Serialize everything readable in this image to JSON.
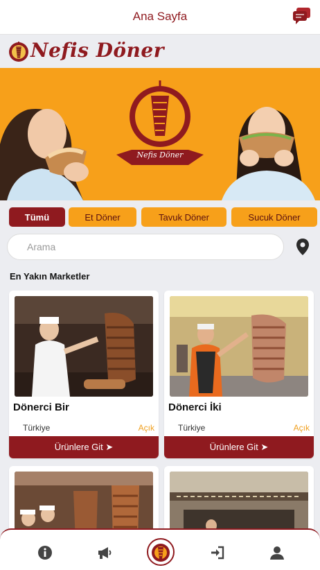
{
  "header": {
    "title": "Ana Sayfa"
  },
  "brand": {
    "name": "Nefis Döner",
    "banner_logo_text": "Nefis Döner"
  },
  "filters": [
    {
      "label": "Tümü",
      "active": true
    },
    {
      "label": "Et Döner",
      "active": false
    },
    {
      "label": "Tavuk Döner",
      "active": false
    },
    {
      "label": "Sucuk Döner",
      "active": false
    }
  ],
  "search": {
    "placeholder": "Arama",
    "value": ""
  },
  "section": {
    "title": "En Yakın Marketler"
  },
  "stores": [
    {
      "name": "Dönerci Bir",
      "country": "Türkiye",
      "status": "Açık",
      "button": "Ürünlere Git ➤"
    },
    {
      "name": "Dönerci İki",
      "country": "Türkiye",
      "status": "Açık",
      "button": "Ürünlere Git ➤"
    }
  ],
  "nav": [
    "info-icon",
    "megaphone-icon",
    "home-logo-icon",
    "sign-in-icon",
    "user-icon"
  ],
  "colors": {
    "primary": "#8f1a1f",
    "accent": "#f7a01a",
    "background": "#ecedf1"
  }
}
